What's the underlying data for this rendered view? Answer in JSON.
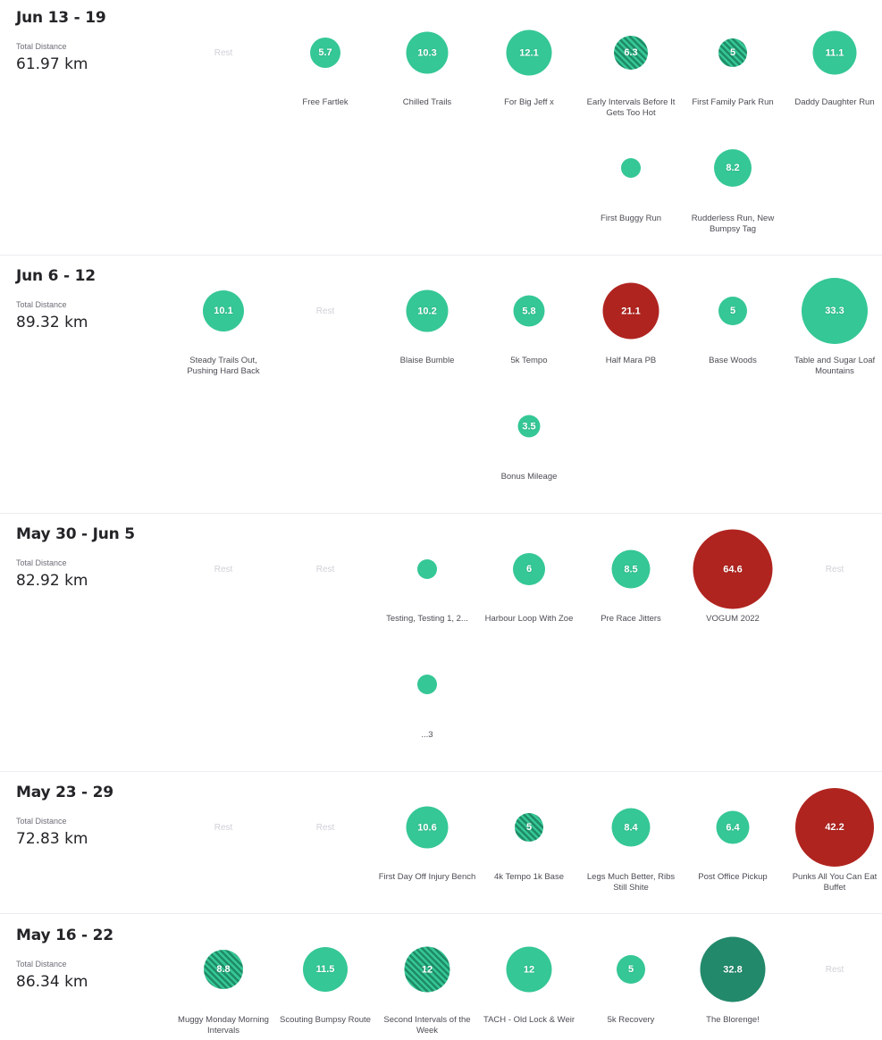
{
  "colors": {
    "run": "#35c796",
    "race": "#b0241f",
    "long_run": "#22896a",
    "rest_text": "#d0d0d8"
  },
  "total_distance_label": "Total Distance",
  "rest_label": "Rest",
  "weeks": [
    {
      "title": "Jun 13 - 19",
      "total": "61.97 km",
      "activities": [
        {
          "value": "5.7",
          "label": "Free Fartlek",
          "type": "run"
        },
        {
          "value": "10.3",
          "label": "Chilled Trails",
          "type": "run"
        },
        {
          "value": "12.1",
          "label": "For Big Jeff x",
          "type": "run"
        },
        {
          "value": "6.3",
          "label": "Early Intervals Before It Gets Too Hot",
          "type": "workout"
        },
        {
          "value": "5",
          "label": "First Family Park Run",
          "type": "workout"
        },
        {
          "value": "11.1",
          "label": "Daddy Daughter Run",
          "type": "run"
        },
        {
          "value": "",
          "label": "First Buggy Run",
          "type": "run"
        },
        {
          "value": "8.2",
          "label": "Rudderless Run, New Bumpsy Tag",
          "type": "run"
        }
      ]
    },
    {
      "title": "Jun 6 - 12",
      "total": "89.32 km",
      "activities": [
        {
          "value": "10.1",
          "label": "Steady Trails Out, Pushing Hard Back",
          "type": "run"
        },
        {
          "value": "10.2",
          "label": "Blaise Bumble",
          "type": "run"
        },
        {
          "value": "5.8",
          "label": "5k Tempo",
          "type": "run"
        },
        {
          "value": "21.1",
          "label": "Half Mara PB",
          "type": "race"
        },
        {
          "value": "5",
          "label": "Base Woods",
          "type": "run"
        },
        {
          "value": "33.3",
          "label": "Table and Sugar Loaf Mountains",
          "type": "run"
        },
        {
          "value": "3.5",
          "label": "Bonus Mileage",
          "type": "run"
        }
      ]
    },
    {
      "title": "May 30 - Jun 5",
      "total": "82.92 km",
      "activities": [
        {
          "value": "",
          "label": "Testing, Testing 1, 2...",
          "type": "run"
        },
        {
          "value": "6",
          "label": "Harbour Loop With Zoe",
          "type": "run"
        },
        {
          "value": "8.5",
          "label": "Pre Race Jitters",
          "type": "run"
        },
        {
          "value": "64.6",
          "label": "VOGUM 2022",
          "type": "race"
        },
        {
          "value": "",
          "label": "...3",
          "type": "run"
        }
      ]
    },
    {
      "title": "May 23 - 29",
      "total": "72.83 km",
      "activities": [
        {
          "value": "10.6",
          "label": "First Day Off Injury Bench",
          "type": "run"
        },
        {
          "value": "5",
          "label": "4k Tempo 1k Base",
          "type": "workout"
        },
        {
          "value": "8.4",
          "label": "Legs Much Better, Ribs Still Shite",
          "type": "run"
        },
        {
          "value": "6.4",
          "label": "Post Office Pickup",
          "type": "run"
        },
        {
          "value": "42.2",
          "label": "Punks All You Can Eat Buffet",
          "type": "race"
        }
      ]
    },
    {
      "title": "May 16 - 22",
      "total": "86.34 km",
      "activities": [
        {
          "value": "8.8",
          "label": "Muggy Monday Morning Intervals",
          "type": "workout"
        },
        {
          "value": "11.5",
          "label": "Scouting Bumpsy Route",
          "type": "run"
        },
        {
          "value": "12",
          "label": "Second Intervals of the Week",
          "type": "workout"
        },
        {
          "value": "12",
          "label": "TACH - Old Lock & Weir",
          "type": "run"
        },
        {
          "value": "5",
          "label": "5k Recovery",
          "type": "run"
        },
        {
          "value": "32.8",
          "label": "The Blorenge!",
          "type": "long"
        }
      ]
    }
  ]
}
